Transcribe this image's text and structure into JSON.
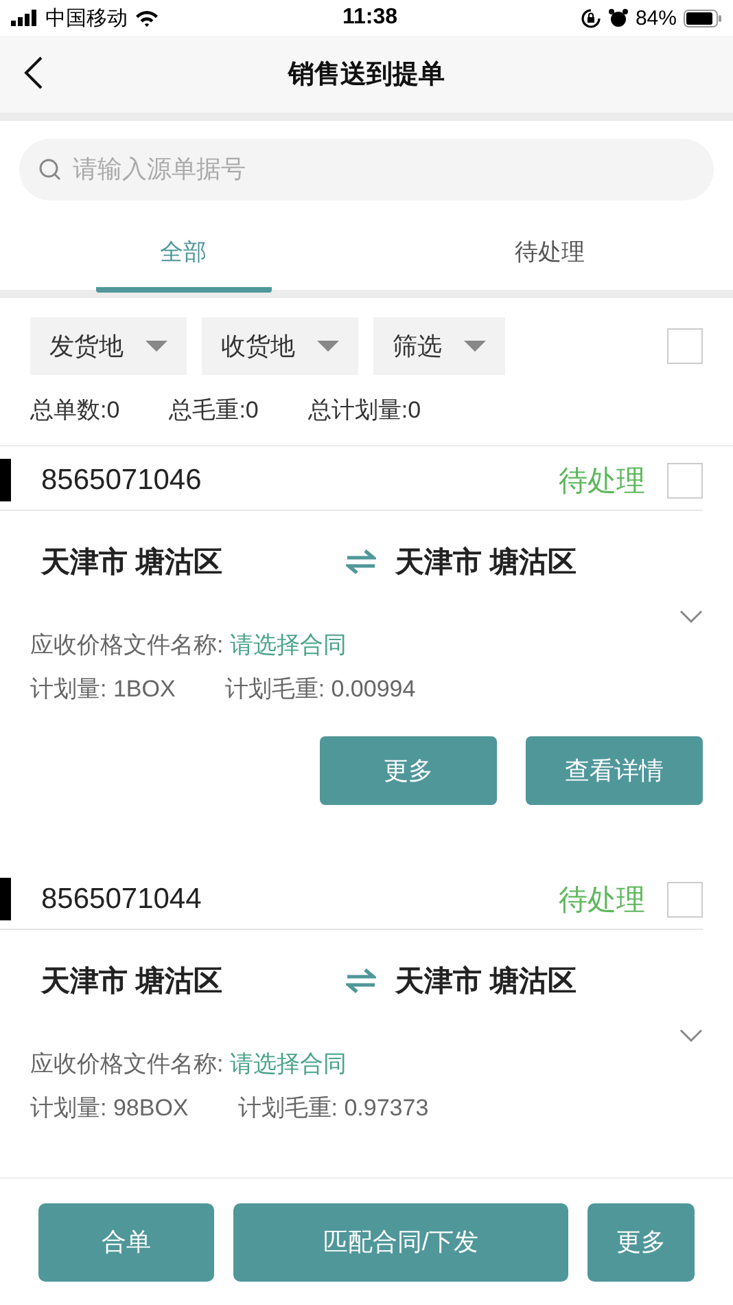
{
  "status_bar": {
    "carrier": "中国移动",
    "time": "11:38",
    "battery": "84%"
  },
  "nav": {
    "title": "销售送到提单"
  },
  "search": {
    "placeholder": "请输入源单据号"
  },
  "tabs": [
    {
      "label": "全部",
      "selected": true
    },
    {
      "label": "待处理",
      "selected": false
    }
  ],
  "filters": [
    "发货地",
    "收货地",
    "筛选"
  ],
  "select_all": {
    "checked": false
  },
  "summary": [
    "总单数:0",
    "总毛重:0",
    "总计划量:0"
  ],
  "orders": [
    {
      "number": "8565071046",
      "status": "待处理",
      "checked": false,
      "from": "天津市 塘沽区",
      "to": "天津市 塘沽区",
      "contract_label": "应收价格文件名称:",
      "contract_value": "请选择合同",
      "plan_qty": "计划量: 1BOX",
      "plan_weight": "计划毛重: 0.00994",
      "actions": [
        "更多",
        "查看详情"
      ]
    },
    {
      "number": "8565071044",
      "status": "待处理",
      "checked": false,
      "from": "天津市 塘沽区",
      "to": "天津市 塘沽区",
      "contract_label": "应收价格文件名称:",
      "contract_value": "请选择合同",
      "plan_qty": "计划量: 98BOX",
      "plan_weight": "计划毛重: 0.97373"
    }
  ],
  "bottom_actions": [
    "合单",
    "匹配合同/下发",
    "更多"
  ]
}
